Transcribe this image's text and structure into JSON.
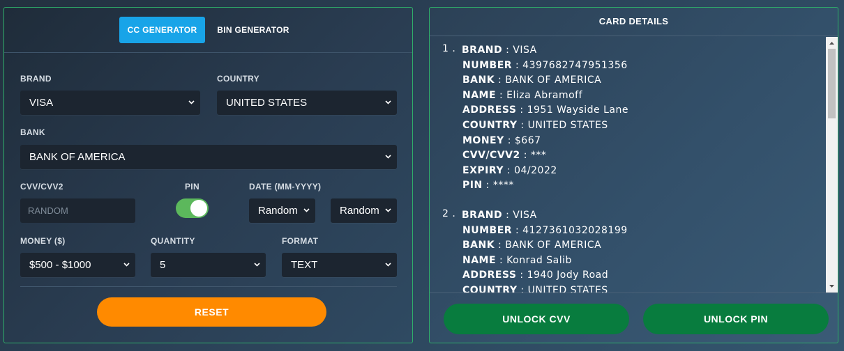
{
  "tabs": {
    "cc": "CC GENERATOR",
    "bin": "BIN GENERATOR"
  },
  "form": {
    "brand": {
      "label": "BRAND",
      "value": "VISA"
    },
    "country": {
      "label": "COUNTRY",
      "value": "UNITED STATES"
    },
    "bank": {
      "label": "BANK",
      "value": "BANK OF AMERICA"
    },
    "cvv": {
      "label": "CVV/CVV2",
      "placeholder": "RANDOM"
    },
    "pin": {
      "label": "PIN",
      "enabled": true
    },
    "date": {
      "label": "DATE (MM-YYYY)",
      "month": "Random",
      "year": "Random"
    },
    "money": {
      "label": "MONEY ($)",
      "value": "$500 - $1000"
    },
    "quantity": {
      "label": "QUANTITY",
      "value": "5"
    },
    "format": {
      "label": "FORMAT",
      "value": "TEXT"
    },
    "reset": "RESET"
  },
  "details": {
    "header": "CARD DETAILS",
    "cards": [
      {
        "num": "1 .",
        "fields": [
          {
            "key": "BRAND",
            "value": "VISA"
          },
          {
            "key": "NUMBER",
            "value": "4397682747951356"
          },
          {
            "key": "BANK",
            "value": "BANK OF AMERICA"
          },
          {
            "key": "NAME",
            "value": "Eliza Abramoff"
          },
          {
            "key": "ADDRESS",
            "value": "1951 Wayside Lane"
          },
          {
            "key": "COUNTRY",
            "value": "UNITED STATES"
          },
          {
            "key": "MONEY",
            "value": "$667"
          },
          {
            "key": "CVV/CVV2",
            "value": "***"
          },
          {
            "key": "EXPIRY",
            "value": "04/2022"
          },
          {
            "key": "PIN",
            "value": "****"
          }
        ]
      },
      {
        "num": "2 .",
        "fields": [
          {
            "key": "BRAND",
            "value": "VISA"
          },
          {
            "key": "NUMBER",
            "value": "4127361032028199"
          },
          {
            "key": "BANK",
            "value": "BANK OF AMERICA"
          },
          {
            "key": "NAME",
            "value": "Konrad Salib"
          },
          {
            "key": "ADDRESS",
            "value": "1940 Jody Road"
          },
          {
            "key": "COUNTRY",
            "value": "UNITED STATES"
          }
        ]
      }
    ],
    "unlock_cvv": "UNLOCK CVV",
    "unlock_pin": "UNLOCK PIN"
  },
  "colors": {
    "accent": "#18a4e8",
    "reset": "#ff8a00",
    "unlock": "#087c3e",
    "toggle_on": "#5cb85c",
    "border": "#2fae6a"
  },
  "icons": {
    "select_arrow": "chevron-down-icon",
    "scroll_up": "scroll-up-arrow-icon",
    "scroll_down": "scroll-down-arrow-icon"
  }
}
